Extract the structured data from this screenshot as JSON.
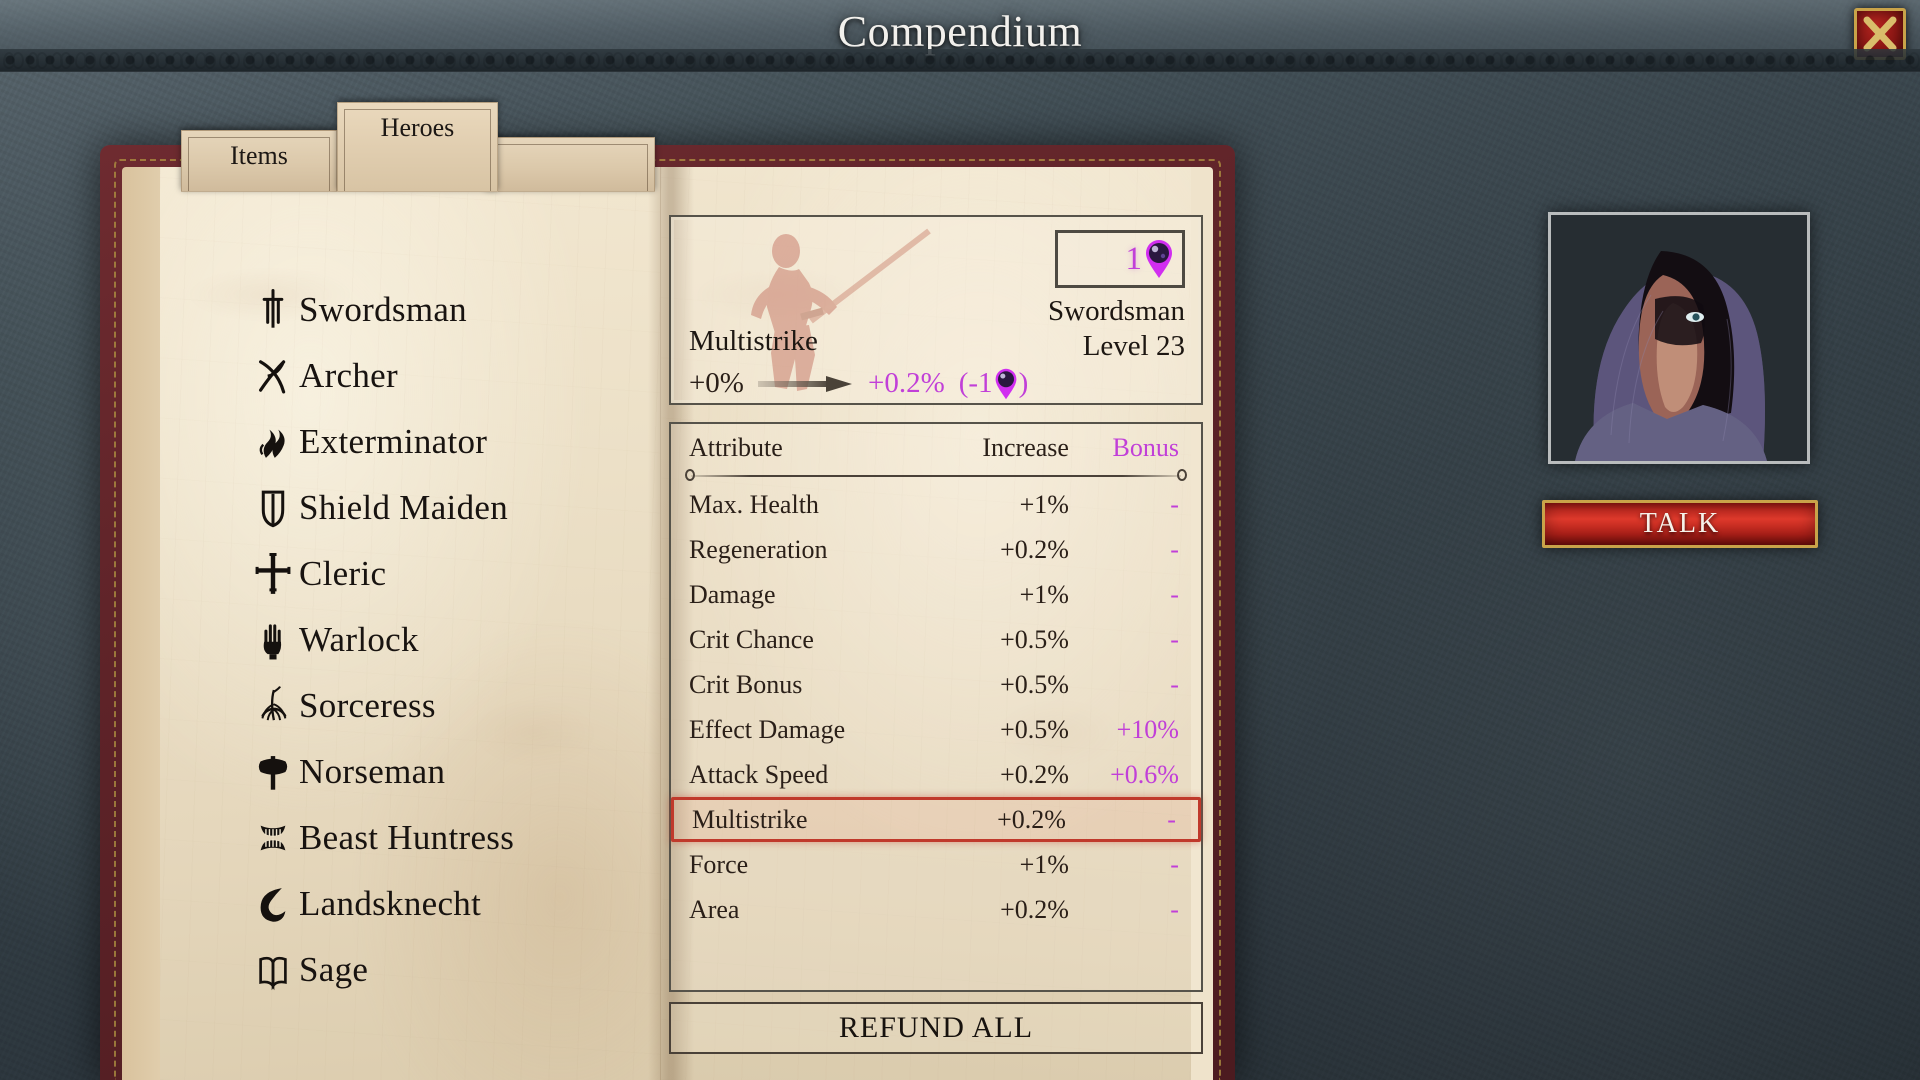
{
  "window": {
    "title": "Compendium",
    "close_icon": "close-x-icon"
  },
  "tabs": [
    {
      "label": "Items",
      "active": false
    },
    {
      "label": "Heroes",
      "active": true
    },
    {
      "label": "",
      "active": false
    }
  ],
  "hero_list": [
    {
      "label": "Swordsman",
      "icon": "sword-hilt-icon",
      "selected": true
    },
    {
      "label": "Archer",
      "icon": "bow-arrow-icon",
      "selected": false
    },
    {
      "label": "Exterminator",
      "icon": "flames-icon",
      "selected": false
    },
    {
      "label": "Shield Maiden",
      "icon": "shield-icon",
      "selected": false
    },
    {
      "label": "Cleric",
      "icon": "cross-icon",
      "selected": false
    },
    {
      "label": "Warlock",
      "icon": "raised-hand-icon",
      "selected": false
    },
    {
      "label": "Sorceress",
      "icon": "roots-orb-icon",
      "selected": false
    },
    {
      "label": "Norseman",
      "icon": "axe-icon",
      "selected": false
    },
    {
      "label": "Beast Huntress",
      "icon": "fanged-jaws-icon",
      "selected": false
    },
    {
      "label": "Landsknecht",
      "icon": "curved-blade-icon",
      "selected": false
    },
    {
      "label": "Sage",
      "icon": "open-book-icon",
      "selected": false
    }
  ],
  "info_card": {
    "gem_count": "1",
    "gem_icon": "purple-gem-icon",
    "hero_name": "Swordsman",
    "hero_level": "Level 23",
    "attribute_name": "Multistrike",
    "value_from": "+0%",
    "value_to": "+0.2%",
    "cost_prefix": "(-1",
    "cost_suffix": ")",
    "arrow_icon": "right-arrow-icon",
    "sketch_icon": "swordsman-sketch-icon"
  },
  "attr_table": {
    "headers": {
      "attribute": "Attribute",
      "increase": "Increase",
      "bonus": "Bonus"
    },
    "rows": [
      {
        "name": "Max. Health",
        "increase": "+1%",
        "bonus": "-",
        "selected": false
      },
      {
        "name": "Regeneration",
        "increase": "+0.2%",
        "bonus": "-",
        "selected": false
      },
      {
        "name": "Damage",
        "increase": "+1%",
        "bonus": "-",
        "selected": false
      },
      {
        "name": "Crit Chance",
        "increase": "+0.5%",
        "bonus": "-",
        "selected": false
      },
      {
        "name": "Crit Bonus",
        "increase": "+0.5%",
        "bonus": "-",
        "selected": false
      },
      {
        "name": "Effect Damage",
        "increase": "+0.5%",
        "bonus": "+10%",
        "selected": false
      },
      {
        "name": "Attack Speed",
        "increase": "+0.2%",
        "bonus": "+0.6%",
        "selected": false
      },
      {
        "name": "Multistrike",
        "increase": "+0.2%",
        "bonus": "-",
        "selected": true
      },
      {
        "name": "Force",
        "increase": "+1%",
        "bonus": "-",
        "selected": false
      },
      {
        "name": "Area",
        "increase": "+0.2%",
        "bonus": "-",
        "selected": false
      }
    ],
    "refund_label": "REFUND ALL"
  },
  "side_panel": {
    "portrait_icon": "hooded-figure-portrait",
    "talk_label": "TALK"
  },
  "colors": {
    "accent_magenta": "#c13fd8",
    "selection_red": "#c0392b",
    "button_red": "#c62c22",
    "gold_border": "#c9a349",
    "ink": "#1d1712",
    "paper": "#ece0c7"
  }
}
